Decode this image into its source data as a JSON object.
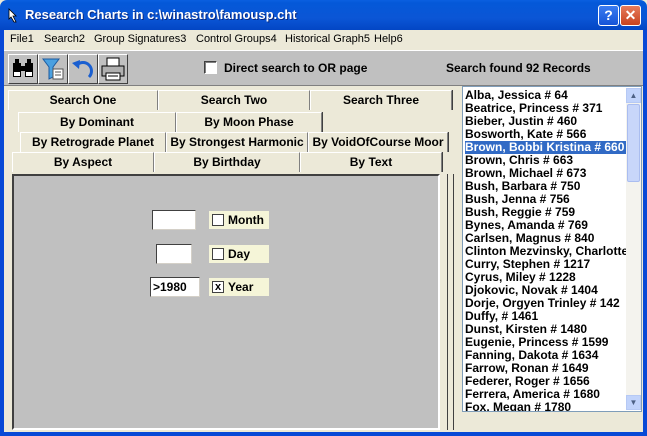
{
  "window": {
    "title": "Research Charts in c:\\winastro\\famousp.cht",
    "help_label": "?",
    "close_label": "✕"
  },
  "menu": [
    {
      "label": "File1"
    },
    {
      "label": "Search2"
    },
    {
      "label": "Group Signatures3"
    },
    {
      "label": "Control Groups4"
    },
    {
      "label": "Historical Graph5"
    },
    {
      "label": "Help6"
    }
  ],
  "toolbar": {
    "direct_search_label": "Direct search to OR page",
    "direct_search_checked": false,
    "found_label": "Search found 92 Records"
  },
  "tabs": {
    "row1": [
      "Search One",
      "Search Two",
      "Search Three"
    ],
    "row2": [
      "By Dominant",
      "By Moon Phase"
    ],
    "row3": [
      "By Retrograde Planet",
      "By Strongest Harmonic",
      "By VoidOfCourse Moor"
    ],
    "row4": [
      "By Aspect",
      "By Birthday",
      "By Text"
    ]
  },
  "birthday": {
    "month": {
      "value": "",
      "label": "Month",
      "checked": false
    },
    "day": {
      "value": "",
      "label": "Day",
      "checked": false
    },
    "year": {
      "value": ">1980",
      "label": "Year",
      "checked": true,
      "check_mark": "x"
    }
  },
  "records": [
    "Alba, Jessica  # 64",
    "Beatrice, Princess  # 371",
    "Bieber, Justin  # 460",
    "Bosworth, Kate  # 566",
    "Brown, Bobbi Kristina  # 660",
    "Brown, Chris  # 663",
    "Brown, Michael  # 673",
    "Bush, Barbara  # 750",
    "Bush, Jenna  # 756",
    "Bush, Reggie  # 759",
    "Bynes, Amanda  # 769",
    "Carlsen, Magnus  # 840",
    "Clinton Mezvinsky, Charlotte",
    "Curry, Stephen  # 1217",
    "Cyrus, Miley  # 1228",
    "Djokovic, Novak  # 1404",
    "Dorje, Orgyen Trinley  # 142",
    "Duffy,   # 1461",
    "Dunst, Kirsten  # 1480",
    "Eugenie, Princess  # 1599",
    "Fanning, Dakota  # 1634",
    "Farrow, Ronan  # 1649",
    "Federer, Roger  # 1656",
    "Ferrera, America  # 1680",
    "Fox, Megan  # 1780"
  ],
  "selected_record_index": 4,
  "colors": {
    "titlebar": "#0458d8",
    "selection": "#316ac5",
    "panel": "#c0c0c0"
  }
}
